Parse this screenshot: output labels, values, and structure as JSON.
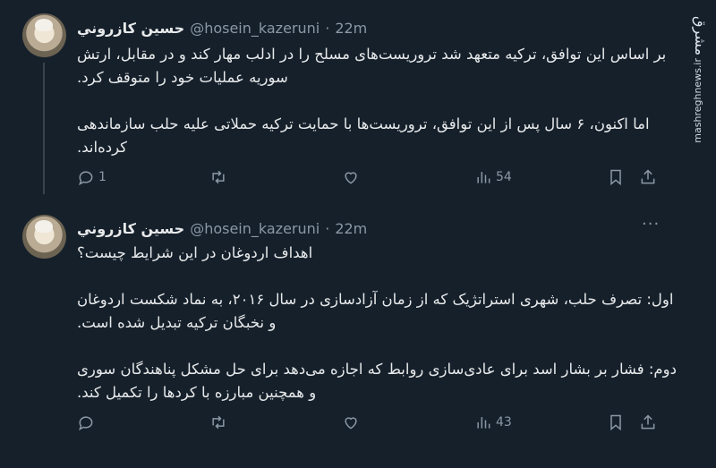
{
  "tweets": [
    {
      "name": "حسين كازروني",
      "handle": "@hosein_kazeruni",
      "dot": "·",
      "time": "22m",
      "more": "···",
      "paragraphs": [
        "بر اساس این توافق، ترکیه متعهد شد تروریست‌های مسلح را در ادلب مهار کند و در مقابل، ارتش سوریه عملیات خود را متوقف کرد.",
        "اما اکنون، ۶ سال پس از این توافق، تروریست‌ها با حمایت ترکیه حملاتی علیه حلب سازماندهی کرده‌اند."
      ],
      "replies": "1",
      "retweets": "",
      "likes": "",
      "views": "54"
    },
    {
      "name": "حسين كازروني",
      "handle": "@hosein_kazeruni",
      "dot": "·",
      "time": "22m",
      "more": "···",
      "paragraphs": [
        "اهداف اردوغان در این شرایط چیست؟",
        "اول: تصرف حلب، شهری استراتژیک که از زمان آزادسازی در سال ۲۰۱۶، به نماد شکست اردوغان و نخبگان ترکیه تبدیل شده است.",
        "دوم: فشار بر بشار اسد برای عادی‌سازی روابط که اجازه می‌دهد برای حل مشکل پناهندگان سوری و همچنین مبارزه با کردها را تکمیل کند."
      ],
      "replies": "",
      "retweets": "",
      "likes": "",
      "views": "43"
    }
  ],
  "watermark": {
    "logo": "مشرق",
    "url": "mashreghnews.ir"
  },
  "icons": [
    "reply-icon",
    "retweet-icon",
    "like-icon",
    "views-icon",
    "bookmark-icon",
    "share-icon"
  ]
}
